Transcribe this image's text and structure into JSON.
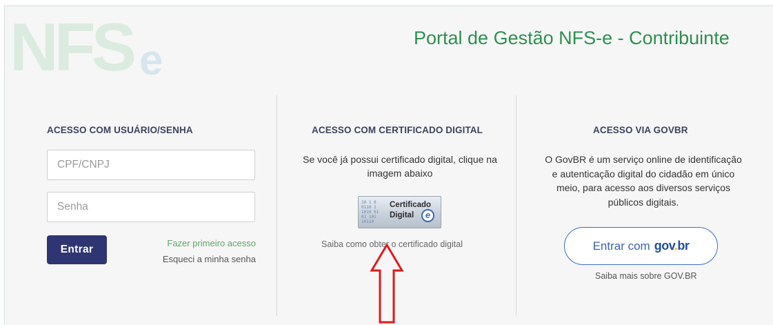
{
  "header": {
    "logo_text": "NFSe",
    "portal_title": "Portal de Gestão NFS-e - Contribuinte"
  },
  "login": {
    "title": "ACESSO COM USUÁRIO/SENHA",
    "cpf_placeholder": "CPF/CNPJ",
    "cpf_value": "",
    "password_placeholder": "Senha",
    "password_value": "",
    "submit_label": "Entrar",
    "first_access_link": "Fazer primeiro acesso",
    "forgot_password_link": "Esqueci a minha senha"
  },
  "certificate": {
    "title": "ACESSO COM CERTIFICADO DIGITAL",
    "description": "Se você já possui certificado digital, clique na imagem abaixo",
    "image_line1": "Certificado",
    "image_line2": "Digital",
    "image_badge": "e",
    "how_to_link": "Saiba como obter o certificado digital"
  },
  "govbr": {
    "title": "ACESSO VIA GOVBR",
    "description": "O GovBR é um serviço online de identificação e autenticação digital do cidadão em único meio, para acesso aos diversos serviços públicos digitais.",
    "button_label": "Entrar com",
    "button_brand_gov": "gov",
    "button_brand_dot": ".",
    "button_brand_br": "br",
    "more_link": "Saiba mais sobre GOV.BR"
  },
  "annotation": {
    "arrow_color": "#e0191b",
    "arrow_icon": "up-arrow-icon"
  },
  "colors": {
    "title_green": "#2e8f4f",
    "button_navy": "#2f3572",
    "link_green": "#5fa464",
    "govbr_blue": "#3d6dc4"
  }
}
